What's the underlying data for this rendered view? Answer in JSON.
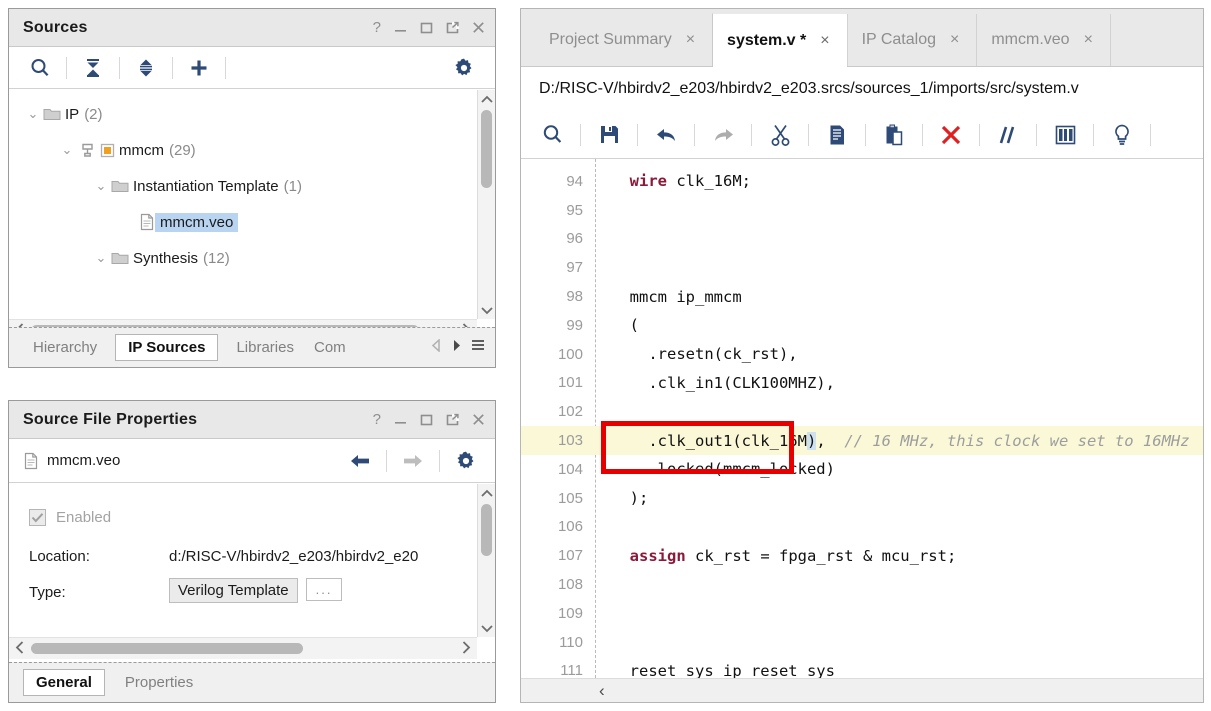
{
  "sources_panel": {
    "title": "Sources",
    "window_buttons": [
      "help-icon",
      "minimize-icon",
      "maximize-icon",
      "float-icon",
      "close-icon"
    ],
    "help_glyph": "?",
    "toolbar": [
      {
        "name": "search-icon",
        "label": "search"
      },
      {
        "name": "collapse-all-icon",
        "label": "collapse all"
      },
      {
        "name": "expand-all-icon",
        "label": "expand all"
      },
      {
        "name": "add-sources-icon",
        "label": "add sources"
      },
      {
        "name": "settings-gear-icon",
        "label": "settings"
      }
    ],
    "tree": [
      {
        "indent": 0,
        "twisty": "⌄",
        "icon": "folder-icon",
        "label": "IP",
        "count": "(2)",
        "selected": false
      },
      {
        "indent": 1,
        "twisty": "⌄",
        "icon": "ip-chip-icon",
        "label": "mmcm",
        "count": "(29)",
        "selected": false
      },
      {
        "indent": 2,
        "twisty": "⌄",
        "icon": "folder-icon",
        "label": "Instantiation Template",
        "count": "(1)",
        "selected": false
      },
      {
        "indent": 3,
        "twisty": "",
        "icon": "file-icon",
        "label": "mmcm.veo",
        "count": "",
        "selected": true
      },
      {
        "indent": 2,
        "twisty": "⌄",
        "icon": "folder-icon",
        "label": "Synthesis",
        "count": "(12)",
        "selected": false
      }
    ],
    "bottom_tabs": [
      {
        "label": "Hierarchy",
        "active": false
      },
      {
        "label": "IP Sources",
        "active": true
      },
      {
        "label": "Libraries",
        "active": false
      },
      {
        "label": "Com",
        "active": false
      }
    ],
    "bottom_nav": [
      "prev-tab-arrow-icon",
      "next-tab-arrow-icon",
      "tab-list-menu-icon"
    ]
  },
  "properties_panel": {
    "title": "Source File Properties",
    "help_glyph": "?",
    "file_name": "mmcm.veo",
    "nav": [
      {
        "name": "back-arrow-icon",
        "enabled": true
      },
      {
        "name": "forward-arrow-icon",
        "enabled": false
      },
      {
        "name": "settings-gear-icon",
        "enabled": true
      }
    ],
    "enabled_label": "Enabled",
    "enabled_checked": true,
    "rows": [
      {
        "key": "Location:",
        "value": "d:/RISC-V/hbirdv2_e203/hbirdv2_e20",
        "kind": "text"
      },
      {
        "key": "Type:",
        "value": "Verilog Template",
        "kind": "field",
        "browse_label": "..."
      }
    ],
    "bottom_tabs": [
      {
        "label": "General",
        "active": true
      },
      {
        "label": "Properties",
        "active": false
      }
    ]
  },
  "editor_panel": {
    "tabs": [
      {
        "label": "Project Summary",
        "active": false,
        "modified": false,
        "close_glyph": "×"
      },
      {
        "label": "system.v *",
        "active": true,
        "modified": true,
        "close_glyph": "×"
      },
      {
        "label": "IP Catalog",
        "active": false,
        "modified": false,
        "close_glyph": "×"
      },
      {
        "label": "mmcm.veo",
        "active": false,
        "modified": false,
        "close_glyph": "×"
      }
    ],
    "file_path": "D:/RISC-V/hbirdv2_e203/hbirdv2_e203.srcs/sources_1/imports/src/system.v",
    "toolbar": [
      {
        "name": "find-icon",
        "label": "find",
        "enabled": true
      },
      {
        "name": "save-icon",
        "label": "save",
        "enabled": true
      },
      {
        "name": "undo-icon",
        "label": "undo",
        "enabled": true
      },
      {
        "name": "redo-icon",
        "label": "redo",
        "enabled": false
      },
      {
        "name": "cut-icon",
        "label": "cut",
        "enabled": true
      },
      {
        "name": "copy-icon",
        "label": "copy",
        "enabled": true
      },
      {
        "name": "paste-icon",
        "label": "paste",
        "enabled": true
      },
      {
        "name": "delete-icon",
        "label": "delete",
        "enabled": true
      },
      {
        "name": "comment-icon",
        "label": "toggle comment",
        "enabled": true
      },
      {
        "name": "columns-icon",
        "label": "column edit",
        "enabled": true
      },
      {
        "name": "bulb-icon",
        "label": "hints",
        "enabled": true
      }
    ],
    "code_lines": [
      {
        "num": "94",
        "highlight": false,
        "segments": [
          {
            "t": "  ",
            "c": "plain"
          },
          {
            "t": "wire",
            "c": "kw"
          },
          {
            "t": " clk_16M;",
            "c": "plain"
          }
        ]
      },
      {
        "num": "95",
        "highlight": false,
        "segments": []
      },
      {
        "num": "96",
        "highlight": false,
        "segments": []
      },
      {
        "num": "97",
        "highlight": false,
        "segments": []
      },
      {
        "num": "98",
        "highlight": false,
        "segments": [
          {
            "t": "  mmcm ip_mmcm",
            "c": "plain"
          }
        ]
      },
      {
        "num": "99",
        "highlight": false,
        "segments": [
          {
            "t": "  (",
            "c": "plain"
          }
        ]
      },
      {
        "num": "100",
        "highlight": false,
        "segments": [
          {
            "t": "    .resetn(ck_rst),",
            "c": "plain"
          }
        ]
      },
      {
        "num": "101",
        "highlight": false,
        "segments": [
          {
            "t": "    .clk_in1(CLK100MHZ),",
            "c": "plain"
          }
        ]
      },
      {
        "num": "102",
        "highlight": false,
        "segments": []
      },
      {
        "num": "103",
        "highlight": true,
        "segments": [
          {
            "t": "    .clk_out1(clk_16M",
            "c": "plain"
          },
          {
            "t": ")",
            "c": "caret"
          },
          {
            "t": ",  ",
            "c": "plain"
          },
          {
            "t": "// 16 MHz, this clock we set to 16MHz",
            "c": "cmt"
          }
        ]
      },
      {
        "num": "104",
        "highlight": false,
        "segments": [
          {
            "t": "    .locked(mmcm_locked)",
            "c": "plain"
          }
        ]
      },
      {
        "num": "105",
        "highlight": false,
        "segments": [
          {
            "t": "  );",
            "c": "plain"
          }
        ]
      },
      {
        "num": "106",
        "highlight": false,
        "segments": []
      },
      {
        "num": "107",
        "highlight": false,
        "segments": [
          {
            "t": "  ",
            "c": "plain"
          },
          {
            "t": "assign",
            "c": "kw"
          },
          {
            "t": " ck_rst = fpga_rst & mcu_rst;",
            "c": "plain"
          }
        ]
      },
      {
        "num": "108",
        "highlight": false,
        "segments": []
      },
      {
        "num": "109",
        "highlight": false,
        "segments": []
      },
      {
        "num": "110",
        "highlight": false,
        "segments": []
      },
      {
        "num": "111",
        "highlight": false,
        "segments": [
          {
            "t": "  reset_sys ip_reset_sys",
            "c": "plain"
          }
        ]
      }
    ],
    "annotation": {
      "name": "red-highlight-box",
      "color": "#e60000"
    },
    "hscroll_left_glyph": "‹"
  },
  "colors": {
    "accent_blue": "#2e4a77",
    "selection_blue": "#b9d4f0",
    "highlight_line": "#fbf8d8",
    "keyword_maroon": "#8b1a3a",
    "comment_gray": "#9d9d9d",
    "annotation_red": "#e60000",
    "ip_orange": "#f0a020"
  }
}
